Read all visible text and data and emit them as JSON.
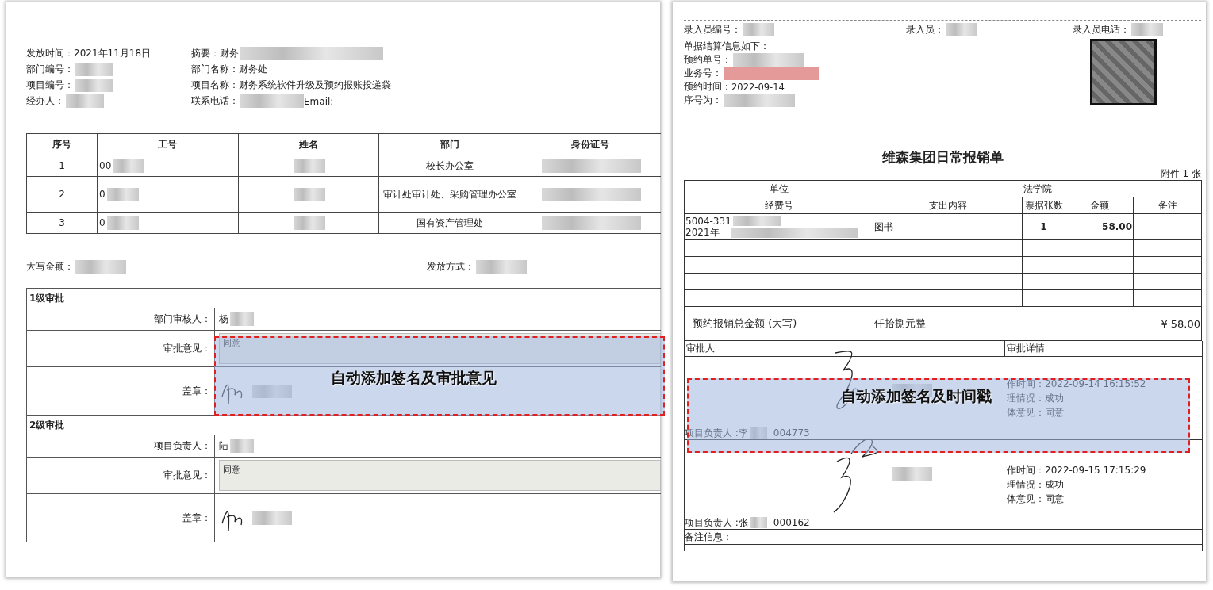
{
  "left_form": {
    "info_fields": [
      {
        "label": "发放时间：",
        "value": "2021年11月18日"
      },
      {
        "label": "摘要：",
        "value": "财务",
        "redacted": true
      },
      {
        "label": "部门编号：",
        "redacted": true
      },
      {
        "label": "部门名称：",
        "value": "财务处"
      },
      {
        "label": "项目编号：",
        "redacted": true
      },
      {
        "label": "项目名称：",
        "value": "财务系统软件升级及预约报账投递袋"
      },
      {
        "label": "经办人：",
        "redacted": true
      },
      {
        "label": "联系电话：",
        "redacted": true,
        "extra_label": "Email:"
      }
    ],
    "table": {
      "columns": [
        "序号",
        "工号",
        "姓名",
        "部门",
        "身份证号"
      ],
      "rows": [
        [
          {
            "text": "1"
          },
          {
            "text": "00",
            "redacted": true
          },
          {
            "redacted": true
          },
          {
            "text": "校长办公室"
          },
          {
            "redacted": true
          }
        ],
        [
          {
            "text": "2"
          },
          {
            "text": "0",
            "redacted": true
          },
          {
            "redacted": true
          },
          {
            "text": "审计处审计处、采购管理办公室"
          },
          {
            "redacted": true
          }
        ],
        [
          {
            "text": "3"
          },
          {
            "text": "0",
            "redacted": true
          },
          {
            "redacted": true
          },
          {
            "text": "国有资产管理处"
          },
          {
            "redacted": true
          }
        ]
      ]
    },
    "summary_fields": [
      {
        "label": "大写金额：",
        "redacted": true
      },
      {
        "label": "发放方式：",
        "redacted": true
      }
    ],
    "approval_levels": [
      {
        "title": "1级审批",
        "rows": [
          {
            "kind": "person",
            "label": "部门审核人：",
            "value": "杨",
            "redacted": true
          },
          {
            "kind": "opinion",
            "label": "审批意见：",
            "value": "同意"
          },
          {
            "kind": "seal",
            "label": "盖章："
          }
        ]
      },
      {
        "title": "2级审批",
        "rows": [
          {
            "kind": "person",
            "label": "项目负责人：",
            "value": "陆",
            "redacted": true
          },
          {
            "kind": "opinion",
            "label": "审批意见：",
            "value": "同意"
          },
          {
            "kind": "seal",
            "label": "盖章："
          }
        ]
      }
    ],
    "annotation": "自动添加签名及审批意见"
  },
  "right_form": {
    "entry_fields": [
      {
        "label": "录入员编号：",
        "redacted": true
      },
      {
        "label": "录入员：",
        "redacted": true
      },
      {
        "label": "录入员电话：",
        "redacted": true
      }
    ],
    "settlement_title": "单据结算信息如下：",
    "settlement_fields": [
      {
        "label": "预约单号：",
        "redacted": true
      },
      {
        "label": "业务号：",
        "redacted": true,
        "color": "#e59a9a"
      },
      {
        "label": "预约时间：",
        "value": "2022-09-14"
      },
      {
        "label": "序号为：",
        "redacted": true
      }
    ],
    "title": "维森集团日常报销单",
    "attachment": "附件 1 张",
    "table": {
      "unit_label": "单位",
      "unit_value": "法学院",
      "columns": [
        "经费号",
        "支出内容",
        "票据张数",
        "金额",
        "备注"
      ],
      "rows": [
        {
          "fund_lines": [
            {
              "text": "5004-331",
              "redacted": true
            },
            {
              "text": "2021年一",
              "redacted": true
            }
          ],
          "content": "图书",
          "count": "1",
          "amount": "58.00"
        }
      ],
      "total_label": "预约报销总金额 (大写)",
      "total_words": "仟拾捌元整",
      "total_amount": "¥ 58.00"
    },
    "approval": {
      "columns": [
        "审批人",
        "审批详情"
      ],
      "entries": [
        {
          "signer": "项目负责人 :李",
          "signer_code": "004773",
          "details": [
            "作时间：2022-09-14 16:15:52",
            "理情况：成功",
            "体意见：同意"
          ]
        },
        {
          "signer": "项目负责人 :张",
          "signer_code": "000162",
          "details": [
            "作时间：2022-09-15 17:15:29",
            "理情况：成功",
            "体意见：同意"
          ]
        }
      ],
      "remarks_label": "备注信息："
    },
    "annotation": "自动添加签名及时间戳"
  }
}
